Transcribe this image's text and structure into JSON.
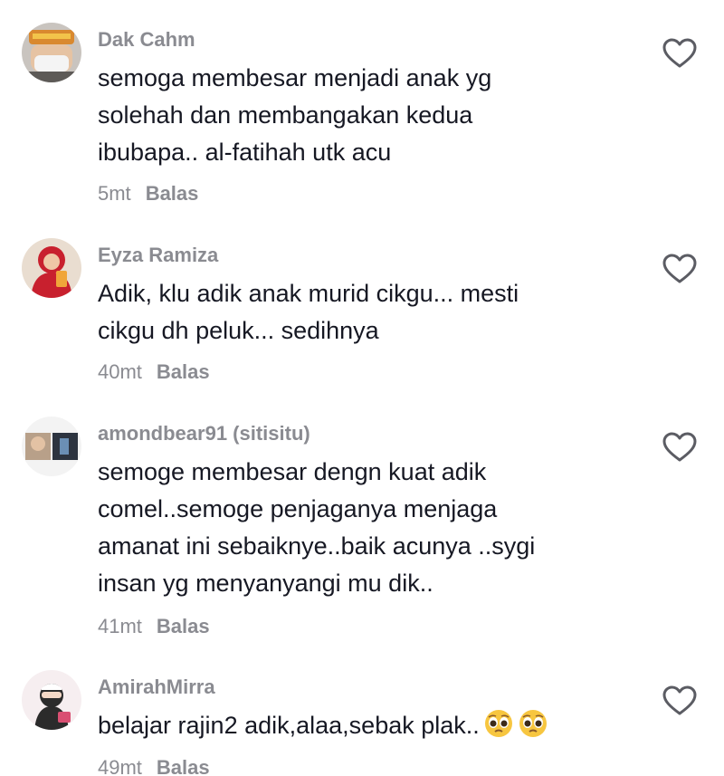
{
  "comments": [
    {
      "username": "Dak Cahm",
      "lines": [
        "semoga membesar menjadi anak yg",
        "solehah dan membangakan kedua",
        "ibubapa.. al-fatihah utk acu"
      ],
      "time": "5mt",
      "reply_label": "Balas",
      "like_icon": "heart-outline-icon"
    },
    {
      "username": "Eyza Ramiza",
      "lines": [
        "Adik, klu adik anak murid cikgu... mesti",
        "cikgu dh peluk... sedihnya"
      ],
      "time": "40mt",
      "reply_label": "Balas",
      "like_icon": "heart-outline-icon"
    },
    {
      "username": "amondbear91 (sitisitu)",
      "lines": [
        "semoge membesar dengn kuat adik",
        "comel..semoge penjaganya menjaga",
        "amanat ini sebaiknye..baik acunya ..sygi",
        "insan yg menyanyangi mu dik.."
      ],
      "time": "41mt",
      "reply_label": "Balas",
      "like_icon": "heart-outline-icon"
    },
    {
      "username": "AmirahMirra",
      "lines": [
        "belajar rajin2 adik,alaa,sebak plak.."
      ],
      "emojis": [
        "pleading-face-emoji",
        "pleading-face-emoji"
      ],
      "time": "49mt",
      "reply_label": "Balas",
      "like_icon": "heart-outline-icon"
    }
  ],
  "colors": {
    "text": "#161823",
    "muted": "#8a8b91",
    "icon": "#5b5c63"
  }
}
